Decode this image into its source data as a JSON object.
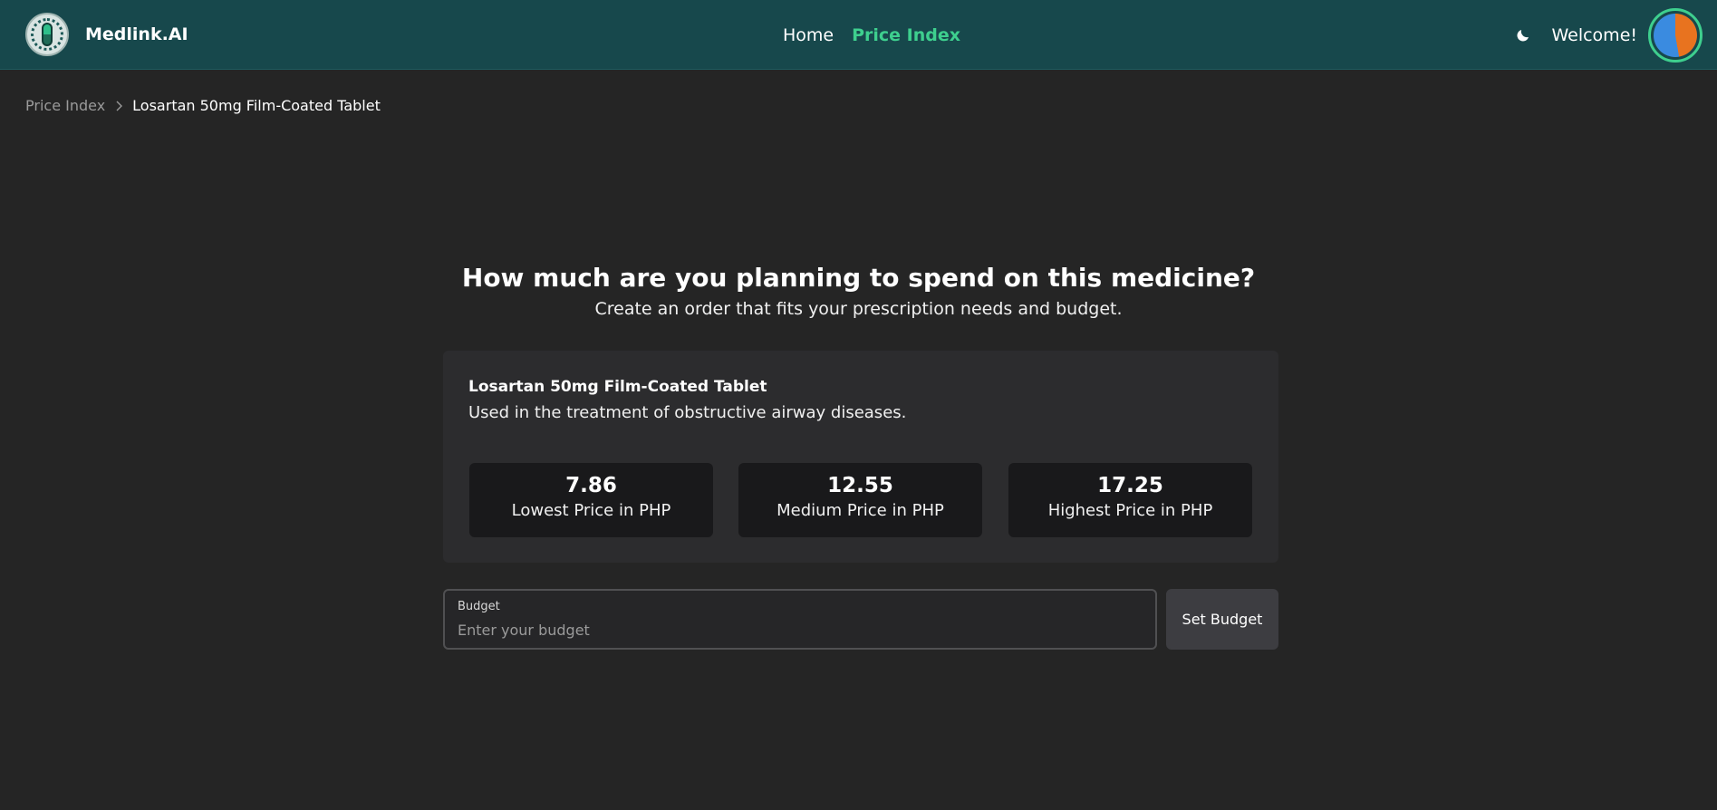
{
  "navbar": {
    "brand_name": "Medlink.AI",
    "links": [
      {
        "label": "Home",
        "active": false
      },
      {
        "label": "Price Index",
        "active": true
      }
    ],
    "theme_icon": "moon-icon",
    "welcome_text": "Welcome!"
  },
  "breadcrumb": {
    "parent": "Price Index",
    "separator_icon": "chevron-right-icon",
    "current": "Losartan 50mg Film-Coated Tablet"
  },
  "main": {
    "heading": "How much are you planning to spend on this medicine?",
    "subheading": "Create an order that fits your prescription needs and budget."
  },
  "medicine": {
    "name": "Losartan 50mg Film-Coated Tablet",
    "description": "Used in the treatment of obstructive airway diseases.",
    "prices": [
      {
        "value": "7.86",
        "label": "Lowest Price in PHP"
      },
      {
        "value": "12.55",
        "label": "Medium Price in PHP"
      },
      {
        "value": "17.25",
        "label": "Highest Price in PHP"
      }
    ]
  },
  "budget": {
    "label": "Budget",
    "placeholder": "Enter your budget",
    "value": "",
    "button_label": "Set Budget"
  },
  "colors": {
    "navbar_bg": "#17484c",
    "accent": "#3ecf8e",
    "page_bg": "#252525",
    "card_bg": "#2c2c2e",
    "price_box_bg": "#19191b"
  }
}
